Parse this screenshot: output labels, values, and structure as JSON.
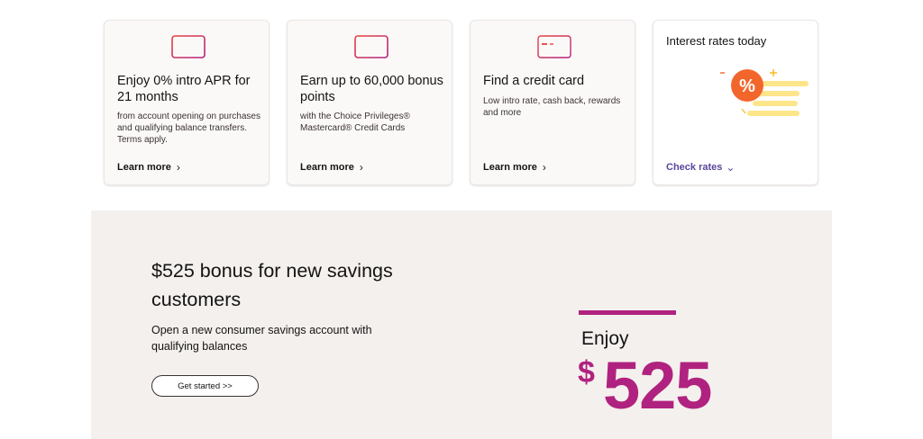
{
  "cards": [
    {
      "icon": "credit-card-icon",
      "title": "Enjoy 0% intro APR for 21 months",
      "description": "from account opening on purchases and qualifying balance transfers. Terms apply.",
      "link": "Learn more"
    },
    {
      "icon": "credit-card-icon",
      "title": "Earn up to 60,000 bonus points",
      "description": "with the Choice Privileges® Mastercard® Credit Cards",
      "link": "Learn more"
    },
    {
      "icon": "credit-card-outline-icon",
      "title": "Find a credit card",
      "description": "Low intro rate, cash back, rewards and more",
      "link": "Learn more"
    }
  ],
  "rates": {
    "title": "Interest rates today",
    "icon": "percent-rates-illustration",
    "link": "Check rates"
  },
  "promo": {
    "headline": "$525 bonus for new savings customers",
    "subtext": "Open a new consumer savings account with qualifying balances",
    "button": "Get started >>",
    "enjoy": "Enjoy",
    "currency": "$",
    "amount": "525"
  },
  "colors": {
    "brand_magenta": "#b0227f",
    "link_purple": "#5a469b",
    "icon_gradient_start": "#e8423f",
    "icon_gradient_end": "#b0227f",
    "promo_bg": "#f4f0ed",
    "rates_orange": "#f2662c",
    "rates_yellow": "#fde58a"
  }
}
